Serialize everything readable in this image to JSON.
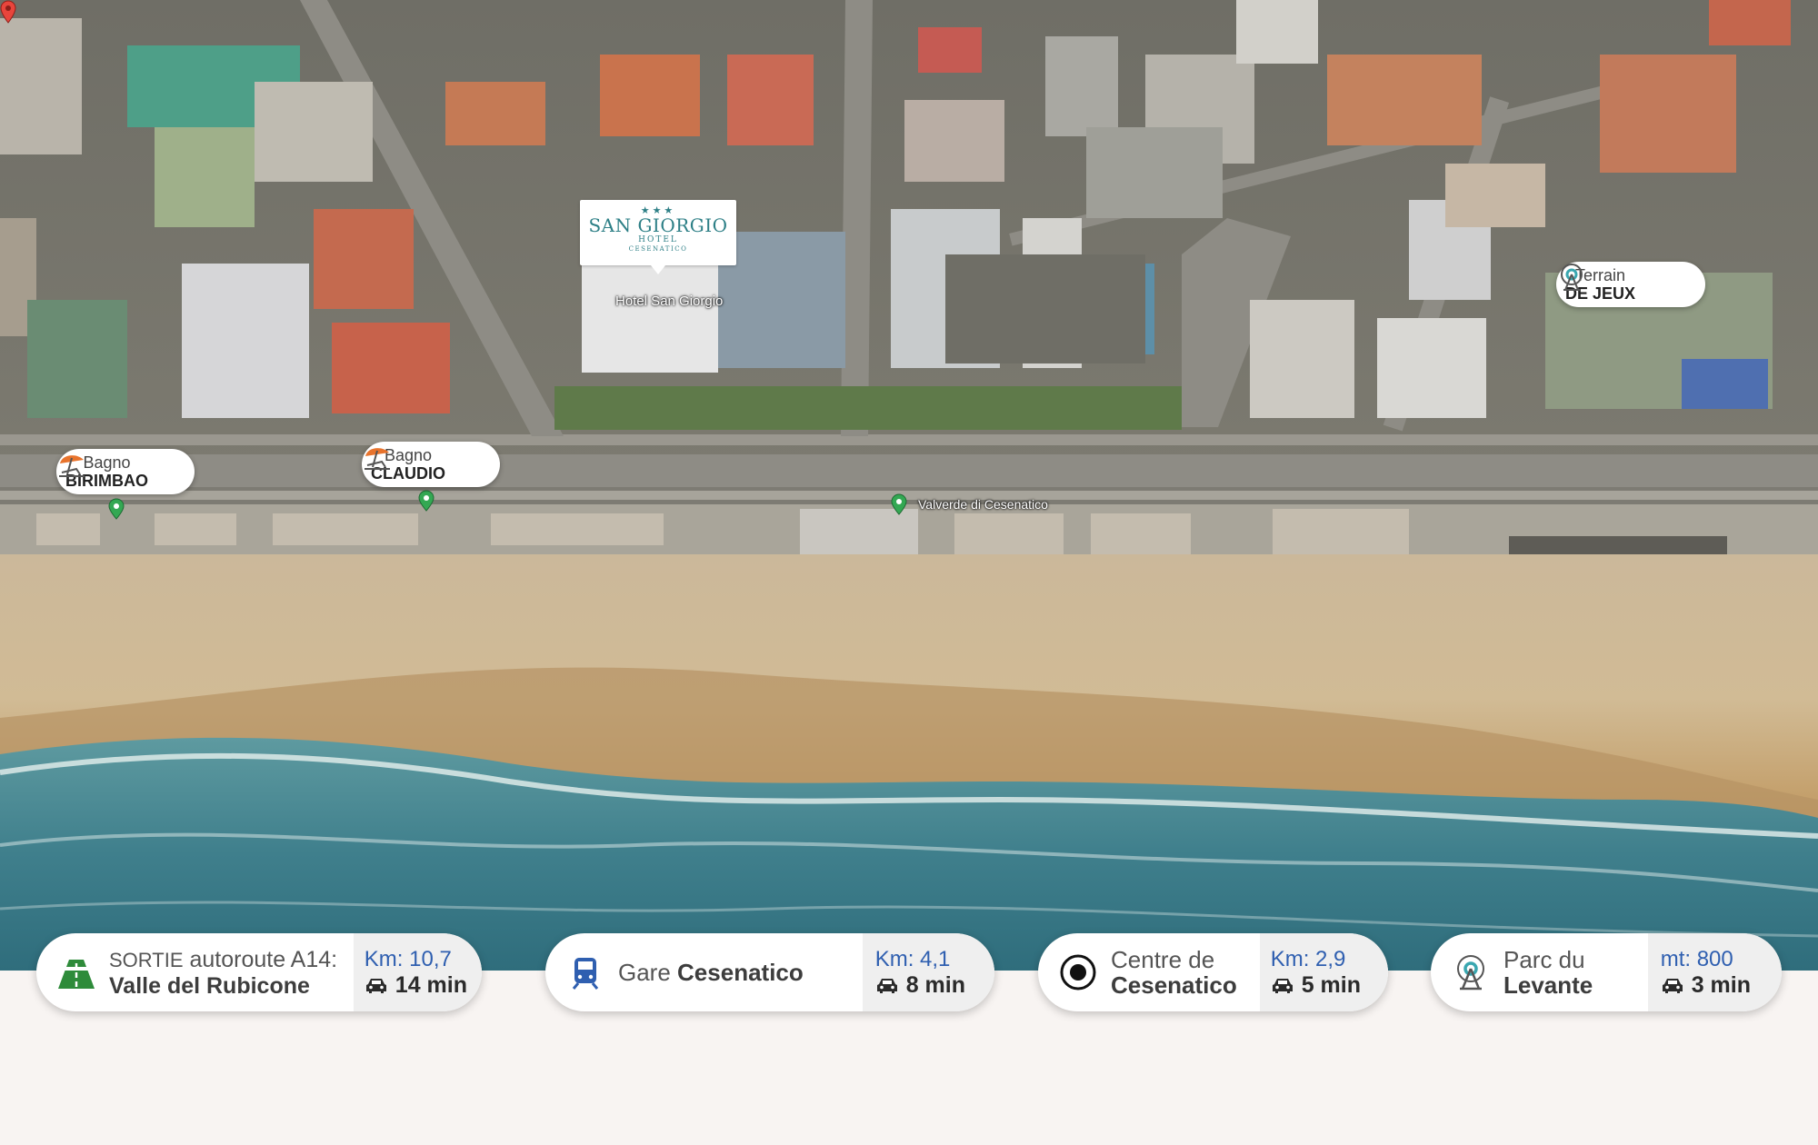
{
  "hotel": {
    "stars": "★★★",
    "logo_name": "SAN GIORGIO",
    "logo_sub": "HOTEL",
    "logo_place": "CESENATICO",
    "map_label": "Hotel San Giorgio",
    "pin_color": "#e8453c"
  },
  "map_places": [
    {
      "label": "Valverde di Cesenatico"
    }
  ],
  "poi": [
    {
      "kind": "Bagno",
      "name": "BIRIMBAO",
      "icon": "beach-umbrella-icon"
    },
    {
      "kind": "Bagno",
      "name": "CLAUDIO",
      "icon": "beach-umbrella-icon"
    },
    {
      "kind": "Terrain",
      "name": "DE JEUX",
      "icon": "ferris-wheel-icon"
    }
  ],
  "cards": [
    {
      "icon": "highway-icon",
      "line1_prefix": "SORTIE",
      "line1_rest": " autoroute A14:",
      "line2": "Valle del Rubicone",
      "distance": "Km: 10,7",
      "time": "14 min"
    },
    {
      "icon": "train-icon",
      "line1_prefix": "Gare ",
      "line1_rest": "Cesenatico",
      "line2": "",
      "distance": "Km: 4,1",
      "time": "8 min"
    },
    {
      "icon": "target-icon",
      "line1_prefix": "Centre de",
      "line1_rest": "",
      "line2": "Cesenatico",
      "distance": "Km: 2,9",
      "time": "5 min"
    },
    {
      "icon": "ferris-wheel-icon",
      "line1_prefix": "Parc du",
      "line1_rest": "",
      "line2": "Levante",
      "distance": "mt: 800",
      "time": "3 min"
    }
  ],
  "colors": {
    "accent_blue": "#2f5fb0",
    "highway_green": "#2e8b3a",
    "poi_orange": "#e8732c",
    "poi_teal": "#3aa7b0"
  }
}
